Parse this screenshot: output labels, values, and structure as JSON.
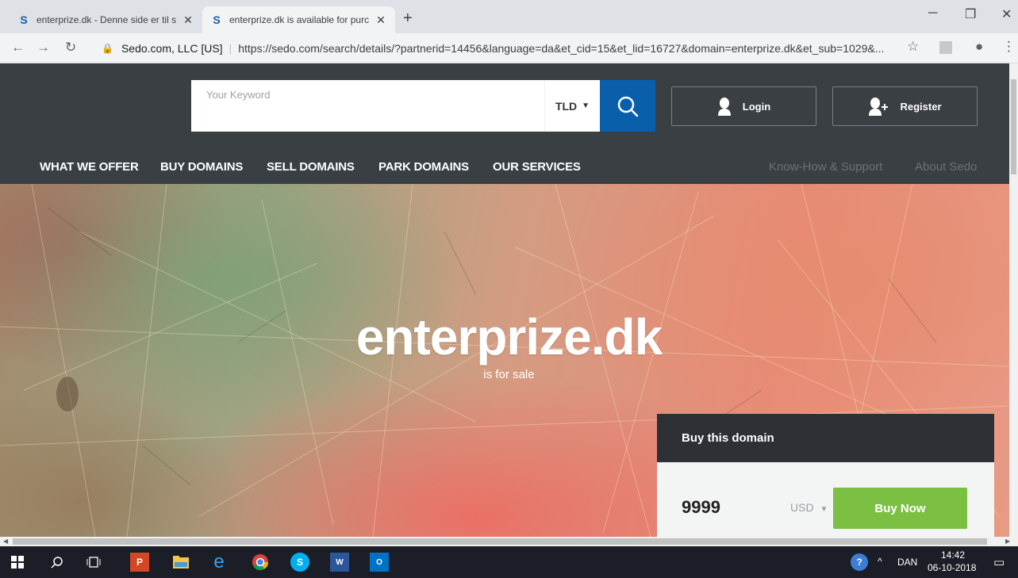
{
  "browser": {
    "tabs": [
      {
        "title": "enterprize.dk - Denne side er til s",
        "favicon": "sedo-favicon",
        "active": false
      },
      {
        "title": "enterprize.dk is available for purc",
        "favicon": "sedo-favicon",
        "active": true
      }
    ],
    "new_tab_label": "+",
    "address": {
      "site_identity": "Sedo.com, LLC [US]",
      "url": "https://sedo.com/search/details/?partnerid=14456&language=da&et_cid=15&et_lid=16727&domain=enterprize.dk&et_sub=1029&..."
    }
  },
  "search": {
    "placeholder": "Your Keyword",
    "tld_label": "TLD"
  },
  "auth": {
    "login_label": "Login",
    "register_label": "Register"
  },
  "nav": {
    "main": [
      "WHAT WE OFFER",
      "BUY DOMAINS",
      "SELL DOMAINS",
      "PARK DOMAINS",
      "OUR SERVICES"
    ],
    "secondary": [
      "Know-How & Support",
      "About Sedo"
    ]
  },
  "hero": {
    "domain": "enterprize.dk",
    "subtitle": "is for sale"
  },
  "buy": {
    "heading": "Buy this domain",
    "price": "9999",
    "currency": "USD",
    "button_label": "Buy Now"
  },
  "colors": {
    "nav_bg": "#3a3f44",
    "search_button": "#0a5fab",
    "buy_button": "#7bc043",
    "buy_head": "#2d3136"
  },
  "taskbar": {
    "language": "DAN",
    "time": "14:42",
    "date": "06-10-2018"
  }
}
